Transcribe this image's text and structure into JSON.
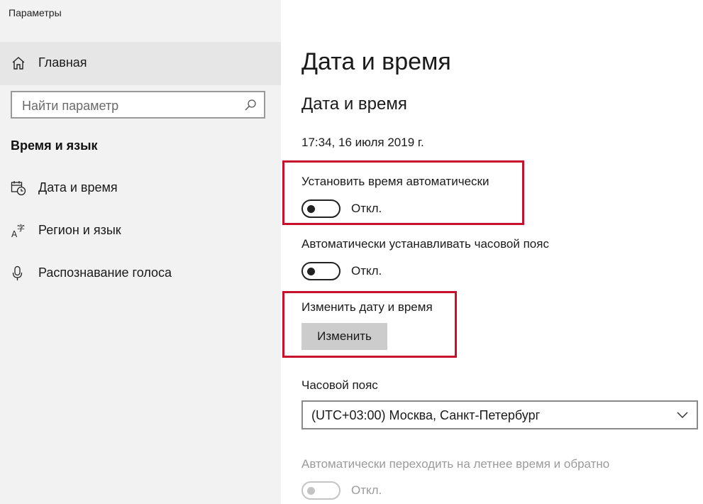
{
  "window": {
    "title": "Параметры"
  },
  "sidebar": {
    "home_label": "Главная",
    "search": {
      "placeholder": "Найти параметр"
    },
    "section_title": "Время и язык",
    "items": [
      {
        "label": "Дата и время",
        "icon": "calendar-clock-icon"
      },
      {
        "label": "Регион и язык",
        "icon": "language-icon"
      },
      {
        "label": "Распознавание голоса",
        "icon": "microphone-icon"
      }
    ]
  },
  "main": {
    "page_title": "Дата и время",
    "section_title": "Дата и время",
    "current_datetime": "17:34, 16 июля 2019 г.",
    "auto_time": {
      "label": "Установить время автоматически",
      "state": "Откл."
    },
    "auto_timezone": {
      "label": "Автоматически устанавливать часовой пояс",
      "state": "Откл."
    },
    "change_datetime": {
      "label": "Изменить дату и время",
      "button": "Изменить"
    },
    "timezone": {
      "label": "Часовой пояс",
      "value": "(UTC+03:00) Москва, Санкт-Петербург"
    },
    "dst": {
      "label": "Автоматически переходить на летнее время и обратно",
      "state": "Откл."
    }
  },
  "colors": {
    "highlight": "#c8102e",
    "sidebar_bg": "#f2f2f2",
    "button_bg": "#cccccc"
  }
}
